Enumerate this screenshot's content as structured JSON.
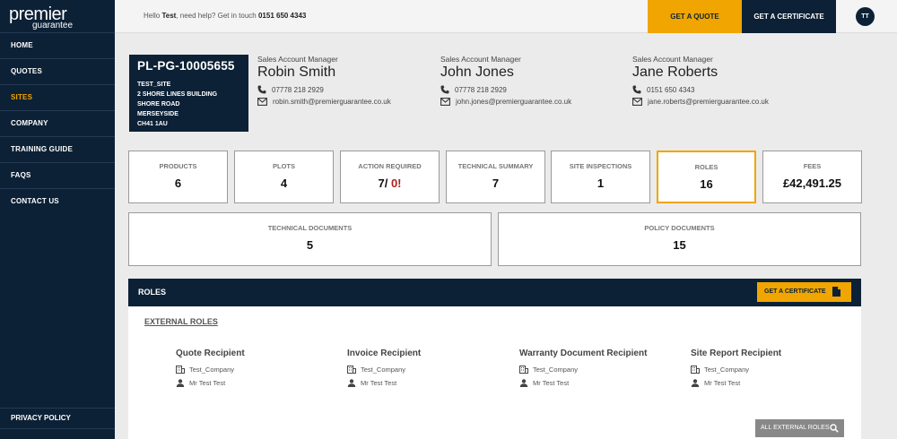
{
  "logo": {
    "top": "premier",
    "bottom": "guarantee"
  },
  "nav": {
    "items": [
      {
        "label": "HOME"
      },
      {
        "label": "QUOTES"
      },
      {
        "label": "SITES"
      },
      {
        "label": "COMPANY"
      },
      {
        "label": "TRAINING GUIDE"
      },
      {
        "label": "FAQS"
      },
      {
        "label": "CONTACT US"
      }
    ],
    "privacy": "PRIVACY POLICY"
  },
  "topbar": {
    "hello": "Hello",
    "user": "Test",
    "help": ", need help? Get in touch",
    "phone": "0151 650 4343",
    "quote_btn": "GET A QUOTE",
    "cert_btn": "GET A CERTIFICATE",
    "avatar": "TT"
  },
  "site": {
    "ref": "PL-PG-10005655",
    "lines": [
      "TEST_SITE",
      "2 SHORE LINES BUILDING",
      "SHORE ROAD",
      "MERSEYSIDE",
      "CH41 1AU"
    ]
  },
  "managers": [
    {
      "label": "Sales Account Manager",
      "name": "Robin Smith",
      "phone": "07778 218 2929",
      "email": "robin.smith@premierguarantee.co.uk"
    },
    {
      "label": "Sales Account Manager",
      "name": "John Jones",
      "phone": "07778 218 2929",
      "email": "john.jones@premierguarantee.co.uk"
    },
    {
      "label": "Sales Account Manager",
      "name": "Jane Roberts",
      "phone": "0151 650 4343",
      "email": "jane.roberts@premierguarantee.co.uk"
    }
  ],
  "tiles": [
    {
      "label": "PRODUCTS",
      "value": "6"
    },
    {
      "label": "PLOTS",
      "value": "4"
    },
    {
      "label": "ACTION REQUIRED",
      "value": "7/",
      "value_alert": "0!"
    },
    {
      "label": "TECHNICAL SUMMARY",
      "value": "7"
    },
    {
      "label": "SITE INSPECTIONS",
      "value": "1"
    },
    {
      "label": "ROLES",
      "value": "16"
    },
    {
      "label": "FEES",
      "value": "£42,491.25"
    }
  ],
  "wide_tiles": [
    {
      "label": "TECHNICAL DOCUMENTS",
      "value": "5"
    },
    {
      "label": "POLICY DOCUMENTS",
      "value": "15"
    }
  ],
  "roles": {
    "title": "ROLES",
    "cert_btn": "GET A CERTIFICATE",
    "external": "EXTERNAL ROLES",
    "list": [
      {
        "title": "Quote Recipient",
        "company": "Test_Company",
        "person": "Mr Test Test"
      },
      {
        "title": "Invoice Recipient",
        "company": "Test_Company",
        "person": "Mr Test Test"
      },
      {
        "title": "Warranty Document Recipient",
        "company": "Test_Company",
        "person": "Mr Test Test"
      },
      {
        "title": "Site Report Recipient",
        "company": "Test_Company",
        "person": "Mr Test Test"
      }
    ],
    "all_btn": "ALL EXTERNAL ROLES"
  },
  "colors": {
    "navy": "#0c2136",
    "accent": "#f0a500"
  }
}
